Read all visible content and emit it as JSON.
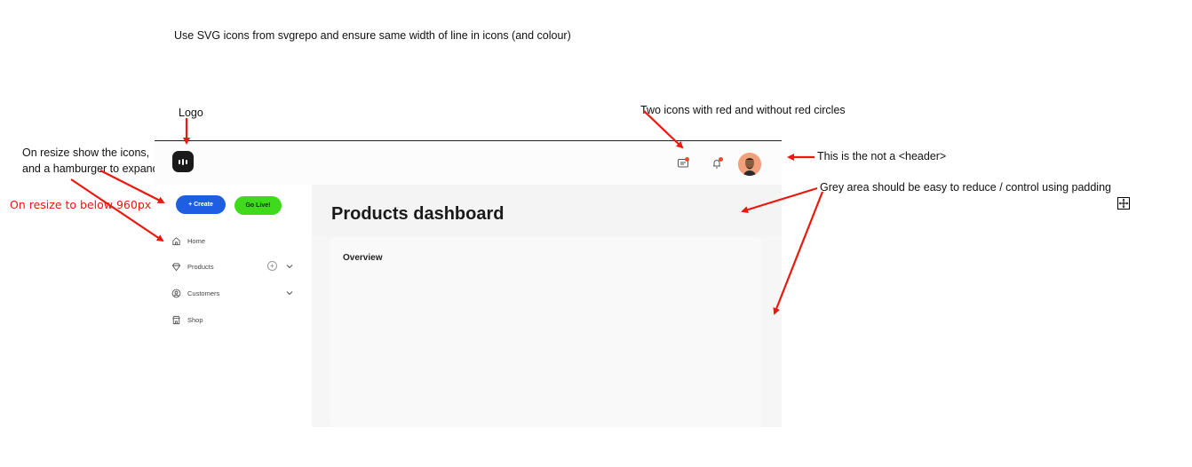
{
  "annotations": {
    "top_note": "Use SVG icons from svgrepo and ensure same width of line in icons (and colour)",
    "logo_note": "Logo",
    "icons_note": "Two icons with red and without red circles",
    "header_note": "This is the not a <header>",
    "grey_note": "Grey area should be easy to reduce / control using padding",
    "resize_note": "On resize show the icons, and a hamburger to expand",
    "below_note": "On resize to below 960px"
  },
  "topbar": {
    "icons": [
      "message-icon",
      "bell-icon"
    ],
    "notification_color": "#ef4a2f"
  },
  "sidebar": {
    "create_label": "+ Create",
    "golive_label": "Go Live!",
    "items": [
      {
        "label": "Home",
        "icon": "home-icon"
      },
      {
        "label": "Products",
        "icon": "diamond-icon"
      },
      {
        "label": "Customers",
        "icon": "user-circle-icon"
      },
      {
        "label": "Shop",
        "icon": "store-icon"
      }
    ]
  },
  "main": {
    "title": "Products dashboard",
    "card_title": "Overview"
  },
  "colors": {
    "primary": "#1d5fe0",
    "live": "#3fda1b",
    "annotation_red": "#e8190e",
    "grey_area": "#f4f4f4"
  }
}
